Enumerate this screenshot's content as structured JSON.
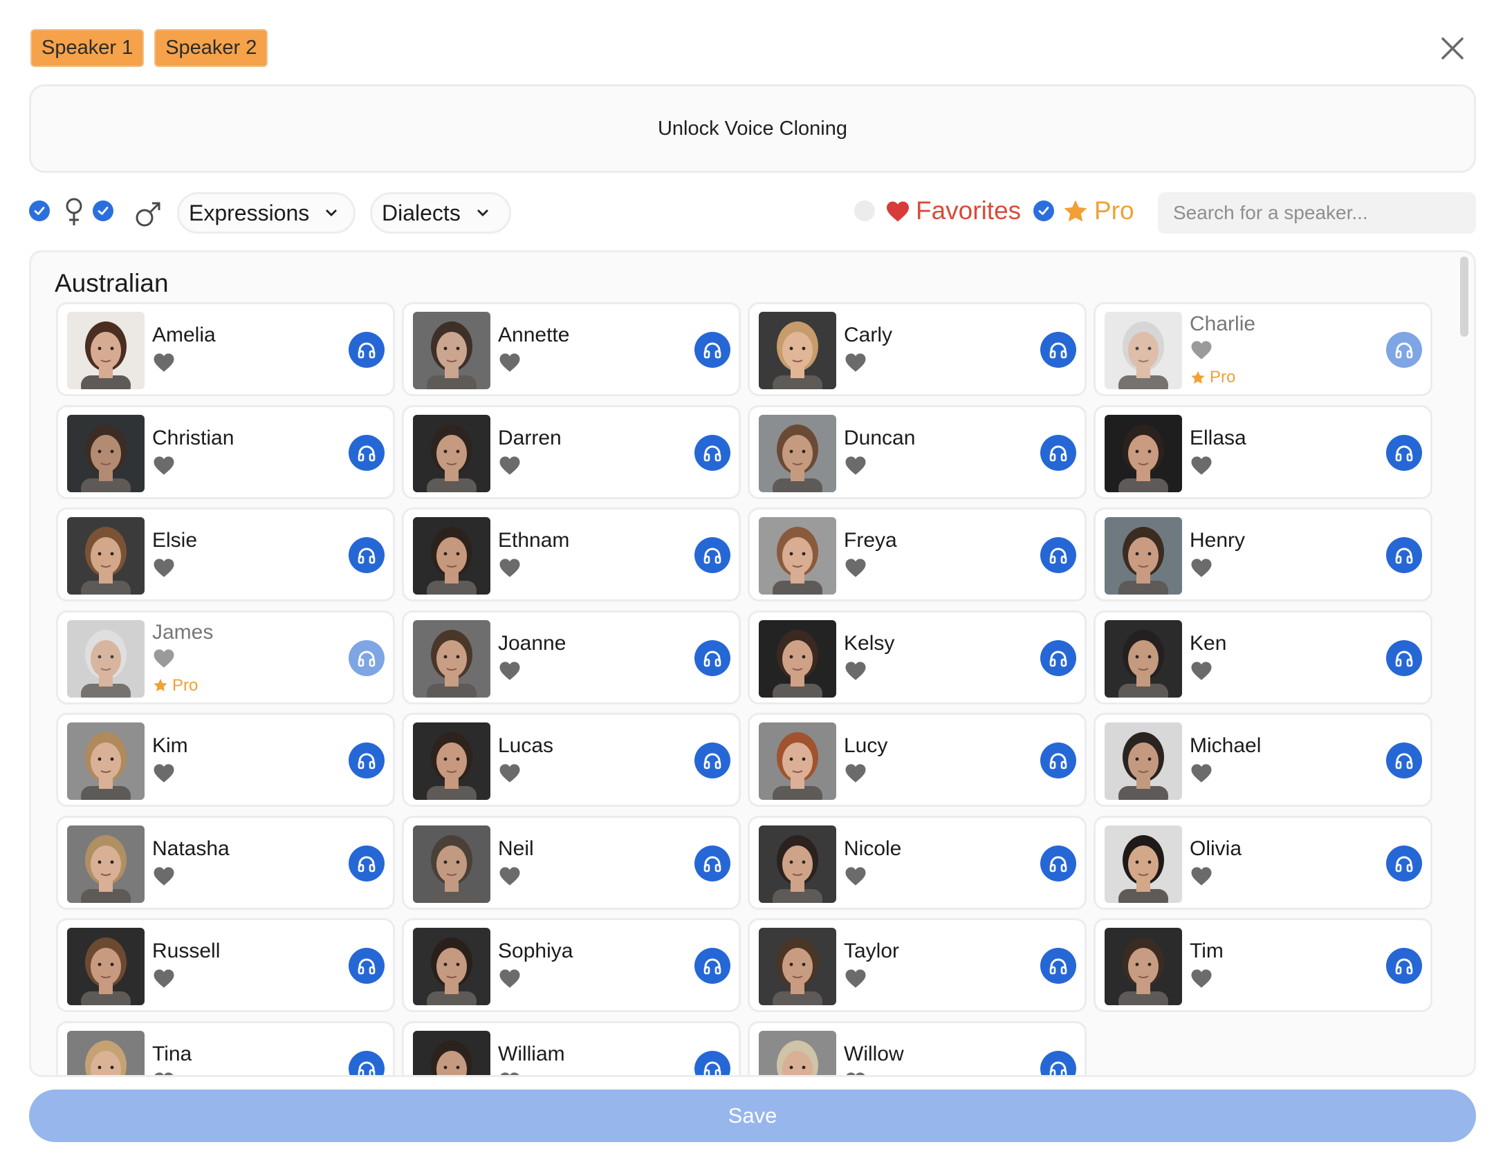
{
  "speaker_tabs": [
    "Speaker 1",
    "Speaker 2"
  ],
  "unlock_banner": "Unlock Voice Cloning",
  "filters": {
    "female_checked": true,
    "male_checked": true,
    "expressions_label": "Expressions",
    "dialects_label": "Dialects",
    "favorites_checked": false,
    "favorites_label": "Favorites",
    "pro_checked": true,
    "pro_label": "Pro",
    "search_placeholder": "Search for a speaker..."
  },
  "section": "Australian",
  "speakers": [
    {
      "name": "Amelia",
      "pro": false,
      "skin": "#d6ab92",
      "hair": "#4a2e22",
      "bg": "#ece8e4"
    },
    {
      "name": "Annette",
      "pro": false,
      "skin": "#caa590",
      "hair": "#3e2f28",
      "bg": "#6b6b6b"
    },
    {
      "name": "Carly",
      "pro": false,
      "skin": "#e0b697",
      "hair": "#c79c6a",
      "bg": "#3a3a3a"
    },
    {
      "name": "Charlie",
      "pro": true,
      "pro_label": "Pro",
      "skin": "#d9b29b",
      "hair": "#cfcfcf",
      "bg": "#e6e6e6"
    },
    {
      "name": "Christian",
      "pro": false,
      "skin": "#b38b72",
      "hair": "#3b2d24",
      "bg": "#2f3336"
    },
    {
      "name": "Darren",
      "pro": false,
      "skin": "#c49a80",
      "hair": "#2e241f",
      "bg": "#2a2a2a"
    },
    {
      "name": "Duncan",
      "pro": false,
      "skin": "#c59b80",
      "hair": "#6b4a35",
      "bg": "#8b8e90"
    },
    {
      "name": "Ellasa",
      "pro": false,
      "skin": "#c99b80",
      "hair": "#2b211d",
      "bg": "#1e1e1e"
    },
    {
      "name": "Elsie",
      "pro": false,
      "skin": "#d3a88a",
      "hair": "#7a5236",
      "bg": "#3b3b3b"
    },
    {
      "name": "Ethnam",
      "pro": false,
      "skin": "#c6987e",
      "hair": "#2c221c",
      "bg": "#2a2a2a"
    },
    {
      "name": "Freya",
      "pro": false,
      "skin": "#d8ad92",
      "hair": "#8a5a3c",
      "bg": "#9b9b9b"
    },
    {
      "name": "Henry",
      "pro": false,
      "skin": "#c99c82",
      "hair": "#3b2c22",
      "bg": "#6f7a80"
    },
    {
      "name": "James",
      "pro": true,
      "pro_label": "Pro",
      "skin": "#d2a98f",
      "hair": "#dadada",
      "bg": "#c9c9c9"
    },
    {
      "name": "Joanne",
      "pro": false,
      "skin": "#c89e84",
      "hair": "#4a372a",
      "bg": "#6e6e6e"
    },
    {
      "name": "Kelsy",
      "pro": false,
      "skin": "#cfa287",
      "hair": "#3b2820",
      "bg": "#232323"
    },
    {
      "name": "Ken",
      "pro": false,
      "skin": "#c59a7f",
      "hair": "#252020",
      "bg": "#2b2b2b"
    },
    {
      "name": "Kim",
      "pro": false,
      "skin": "#d9b196",
      "hair": "#b08a5c",
      "bg": "#8f8f8f"
    },
    {
      "name": "Lucas",
      "pro": false,
      "skin": "#c7997e",
      "hair": "#2d221c",
      "bg": "#2b2b2b"
    },
    {
      "name": "Lucy",
      "pro": false,
      "skin": "#dcb096",
      "hair": "#a0532e",
      "bg": "#8a8a8a"
    },
    {
      "name": "Michael",
      "pro": false,
      "skin": "#c39a80",
      "hair": "#2b231f",
      "bg": "#d8d8d8"
    },
    {
      "name": "Natasha",
      "pro": false,
      "skin": "#d8b096",
      "hair": "#b08f62",
      "bg": "#7a7a7a"
    },
    {
      "name": "Neil",
      "pro": false,
      "skin": "#c29a82",
      "hair": "#4a4038",
      "bg": "#5b5b5b"
    },
    {
      "name": "Nicole",
      "pro": false,
      "skin": "#cea388",
      "hair": "#2b2220",
      "bg": "#3a3a3a"
    },
    {
      "name": "Olivia",
      "pro": false,
      "skin": "#d2a889",
      "hair": "#1f1a18",
      "bg": "#dcdcdc"
    },
    {
      "name": "Russell",
      "pro": false,
      "skin": "#c89b80",
      "hair": "#6b4a30",
      "bg": "#2c2c2c"
    },
    {
      "name": "Sophiya",
      "pro": false,
      "skin": "#c49a80",
      "hair": "#2a201b",
      "bg": "#2e2e2e"
    },
    {
      "name": "Taylor",
      "pro": false,
      "skin": "#c89c80",
      "hair": "#4a3526",
      "bg": "#3a3a3a"
    },
    {
      "name": "Tim",
      "pro": false,
      "skin": "#c79c82",
      "hair": "#3a2c22",
      "bg": "#2b2b2b"
    },
    {
      "name": "Tina",
      "pro": false,
      "skin": "#dab296",
      "hair": "#c4a273",
      "bg": "#7d7d7d"
    },
    {
      "name": "William",
      "pro": false,
      "skin": "#c49a80",
      "hair": "#2b221d",
      "bg": "#2a2a2a"
    },
    {
      "name": "Willow",
      "pro": false,
      "skin": "#d8b096",
      "hair": "#cfc3a8",
      "bg": "#8b8b8b"
    }
  ],
  "save_label": "Save",
  "colors": {
    "accent_blue": "#2667d6",
    "speaker_tab_orange": "#f5a24a",
    "favorites_red": "#d94b3a",
    "pro_orange": "#f0a035",
    "save_disabled": "#97b6ec"
  }
}
